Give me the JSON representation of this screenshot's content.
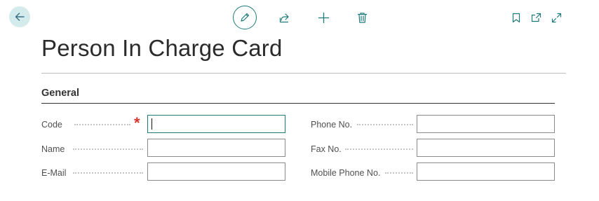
{
  "toolbar": {
    "back_icon": "arrow-left-icon",
    "edit_icon": "pencil-icon",
    "share_icon": "share-icon",
    "new_icon": "plus-icon",
    "delete_icon": "trash-icon",
    "bookmark_icon": "bookmark-icon",
    "popout_icon": "open-in-new-window-icon",
    "expand_icon": "expand-icon",
    "accent_color": "#1d7a7a"
  },
  "page": {
    "title": "Person In Charge Card"
  },
  "section": {
    "title": "General"
  },
  "fields": {
    "code": {
      "label": "Code",
      "value": "",
      "required": true,
      "required_mark": "*"
    },
    "name": {
      "label": "Name",
      "value": ""
    },
    "email": {
      "label": "E-Mail",
      "value": ""
    },
    "phone": {
      "label": "Phone No.",
      "value": ""
    },
    "fax": {
      "label": "Fax No.",
      "value": ""
    },
    "mobile": {
      "label": "Mobile Phone No.",
      "value": ""
    }
  }
}
